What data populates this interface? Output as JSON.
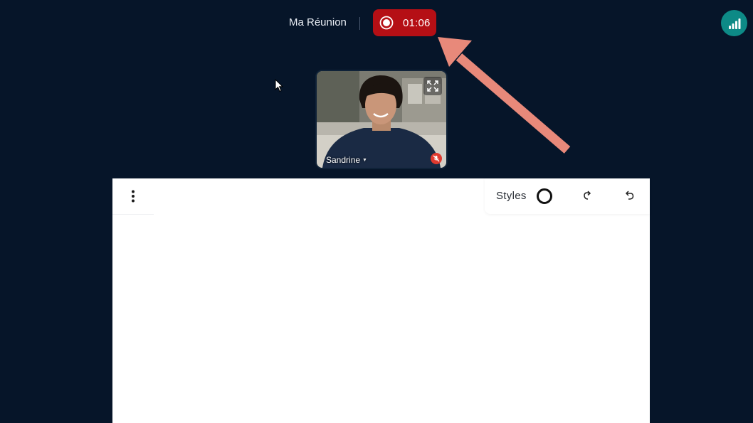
{
  "header": {
    "meeting_title": "Ma Réunion",
    "recording_time": "01:06",
    "recording_color": "#b50f15",
    "signal_icon": "signal-bars-icon",
    "signal_color": "#0d8a86"
  },
  "participant": {
    "name": "Sandrine",
    "mic_status_icon": "mic-off-icon",
    "fullscreen_icon": "fullscreen-icon"
  },
  "whiteboard": {
    "menu_icon": "kebab-menu-icon",
    "styles_label": "Styles",
    "redo_icon": "redo-icon",
    "undo_icon": "undo-icon"
  },
  "annotation": {
    "arrow_color": "#e8897a"
  },
  "theme": {
    "background": "#061529"
  }
}
